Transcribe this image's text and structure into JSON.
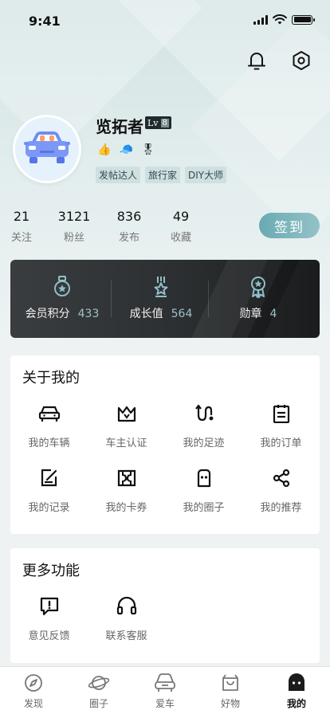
{
  "status_bar": {
    "time": "9:41"
  },
  "profile": {
    "nickname": "览拓者",
    "level_prefix": "Lv",
    "level": "8",
    "emojis": [
      "👍",
      "🧢",
      "🎖"
    ],
    "tags": [
      "发帖达人",
      "旅行家",
      "DIY大师"
    ]
  },
  "stats": [
    {
      "value": "21",
      "label": "关注"
    },
    {
      "value": "3121",
      "label": "粉丝"
    },
    {
      "value": "836",
      "label": "发布"
    },
    {
      "value": "49",
      "label": "收藏"
    }
  ],
  "checkin_label": "签到",
  "member_card": [
    {
      "label": "会员积分",
      "value": "433",
      "icon": "medal-icon"
    },
    {
      "label": "成长值",
      "value": "564",
      "icon": "growth-star-icon"
    },
    {
      "label": "勋章",
      "value": "4",
      "icon": "badge-ribbon-icon"
    }
  ],
  "about_section": {
    "title": "关于我的",
    "items": [
      {
        "label": "我的车辆",
        "icon": "car-icon"
      },
      {
        "label": "车主认证",
        "icon": "crown-icon"
      },
      {
        "label": "我的足迹",
        "icon": "route-icon"
      },
      {
        "label": "我的订单",
        "icon": "clipboard-icon"
      },
      {
        "label": "我的记录",
        "icon": "edit-note-icon"
      },
      {
        "label": "我的卡券",
        "icon": "coupon-icon"
      },
      {
        "label": "我的圈子",
        "icon": "circle-group-icon"
      },
      {
        "label": "我的推荐",
        "icon": "share-icon"
      }
    ]
  },
  "more_section": {
    "title": "更多功能",
    "items": [
      {
        "label": "意见反馈",
        "icon": "feedback-icon"
      },
      {
        "label": "联系客服",
        "icon": "headset-icon"
      }
    ]
  },
  "tab_bar": [
    {
      "label": "发现",
      "icon": "compass-icon"
    },
    {
      "label": "圈子",
      "icon": "planet-icon"
    },
    {
      "label": "爱车",
      "icon": "car-front-icon"
    },
    {
      "label": "好物",
      "icon": "shopping-bag-icon"
    },
    {
      "label": "我的",
      "icon": "profile-face-icon"
    }
  ]
}
